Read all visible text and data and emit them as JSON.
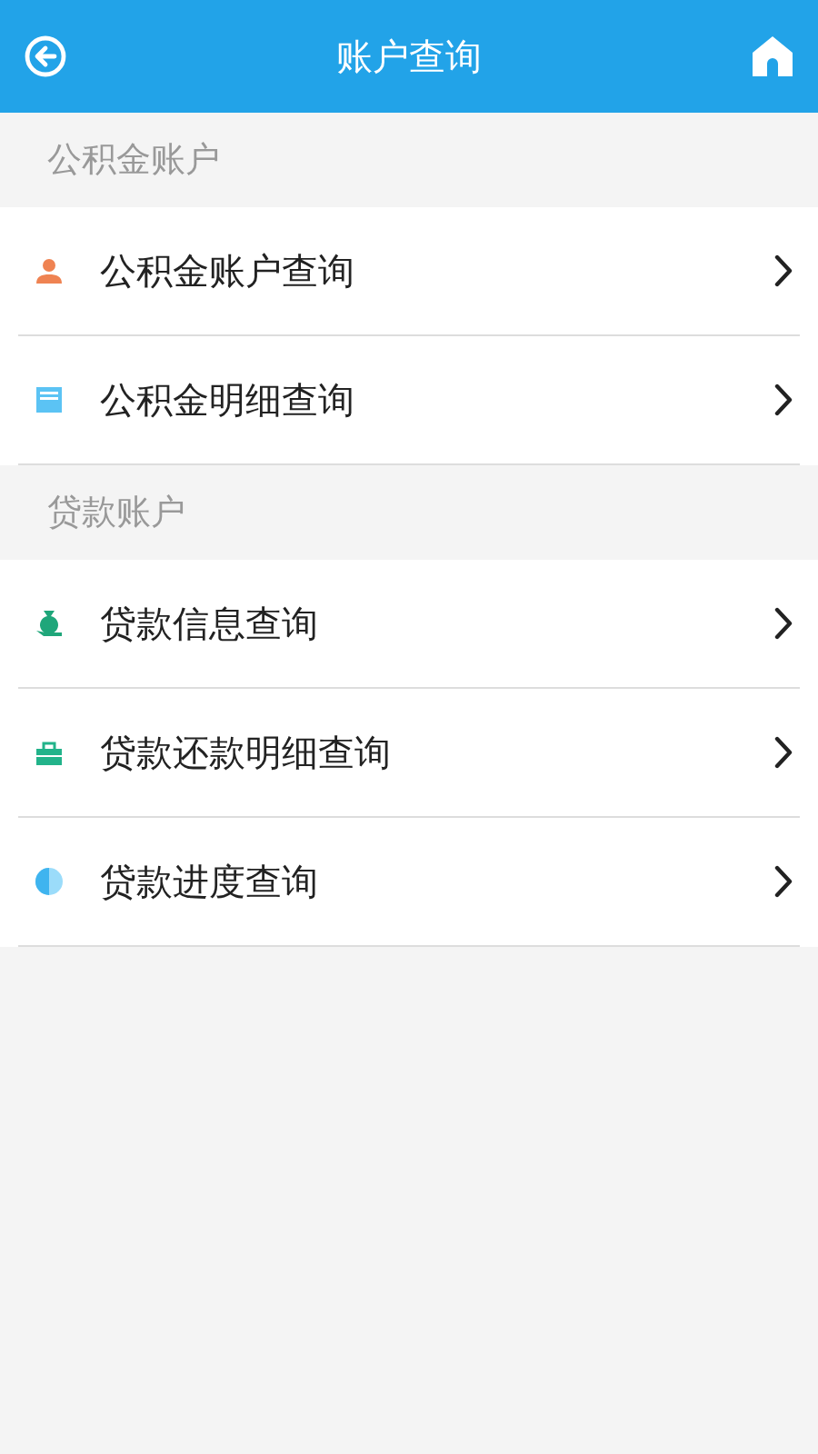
{
  "header": {
    "title": "账户查询"
  },
  "sections": [
    {
      "title": "公积金账户",
      "items": [
        {
          "label": "公积金账户查询"
        },
        {
          "label": "公积金明细查询"
        }
      ]
    },
    {
      "title": "贷款账户",
      "items": [
        {
          "label": "贷款信息查询"
        },
        {
          "label": "贷款还款明细查询"
        },
        {
          "label": "贷款进度查询"
        }
      ]
    }
  ]
}
